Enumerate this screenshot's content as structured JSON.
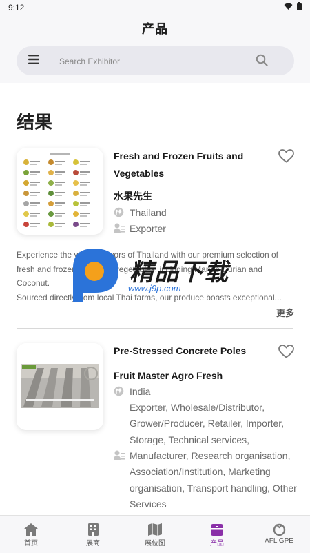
{
  "status": {
    "time": "9:12"
  },
  "header": {
    "title": "产品",
    "search_placeholder": "Search Exhibitor"
  },
  "results_heading": "结果",
  "products": [
    {
      "title": "Fresh and Frozen Fruits and Vegetables",
      "company": "水果先生",
      "country": "Thailand",
      "type": "Exporter",
      "description_lines": [
        "Experience the vibrant flavors of Thailand with our premium selection of",
        "fresh and frozen fruits and vegetables, including Mango Durian and",
        "Coconut.",
        "Sourced directly from local Thai farms, our produce boasts exceptional..."
      ],
      "more_label": "更多"
    },
    {
      "title": "Pre-Stressed Concrete Poles",
      "company": "Fruit Master Agro Fresh",
      "country": "India",
      "type": "Exporter, Wholesale/Distributor, Grower/Producer, Retailer, Importer, Storage, Technical services,",
      "activity": "Manufacturer, Research organisation, Association/Institution, Marketing organisation, Transport handling, Other Services"
    }
  ],
  "watermark": {
    "brand": "精品下载",
    "url": "www.j9p.com"
  },
  "bottom_nav": [
    {
      "label": "首页",
      "icon": "home-icon"
    },
    {
      "label": "展商",
      "icon": "building-icon"
    },
    {
      "label": "展位图",
      "icon": "map-icon"
    },
    {
      "label": "产品",
      "icon": "product-box-icon",
      "active": true
    },
    {
      "label": "AFL GPE",
      "icon": "afl-logo-icon"
    }
  ],
  "colors": {
    "accent": "#8a2fa8",
    "watermark_blue": "#2b73d9",
    "watermark_orange": "#f4a01b"
  }
}
